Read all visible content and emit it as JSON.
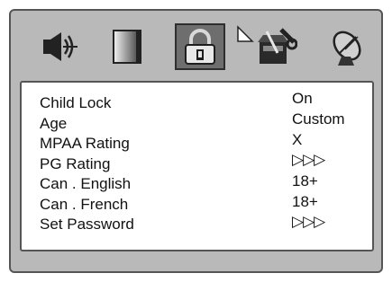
{
  "tabs": [
    {
      "icon": "speaker-icon",
      "label": ""
    },
    {
      "icon": "tv-screen-icon",
      "label": ""
    },
    {
      "icon": "padlock-icon",
      "label": ""
    },
    {
      "icon": "tools-icon",
      "label": ""
    },
    {
      "icon": "satellite-dish-icon",
      "label": ""
    }
  ],
  "selected_tab": "padlock-icon",
  "menu": {
    "labels": [
      "Child Lock",
      "Age",
      "MPAA Rating",
      "PG Rating",
      "Can . English",
      "Can . French",
      "Set Password"
    ],
    "values": [
      "On",
      "Custom",
      "X",
      "▷▷▷",
      "18+",
      "18+",
      "▷▷▷"
    ]
  },
  "colors": {
    "frame": "#b9b9b9",
    "selected_tab": "#6e6e6e",
    "panel": "#ffffff",
    "text": "#111111"
  }
}
